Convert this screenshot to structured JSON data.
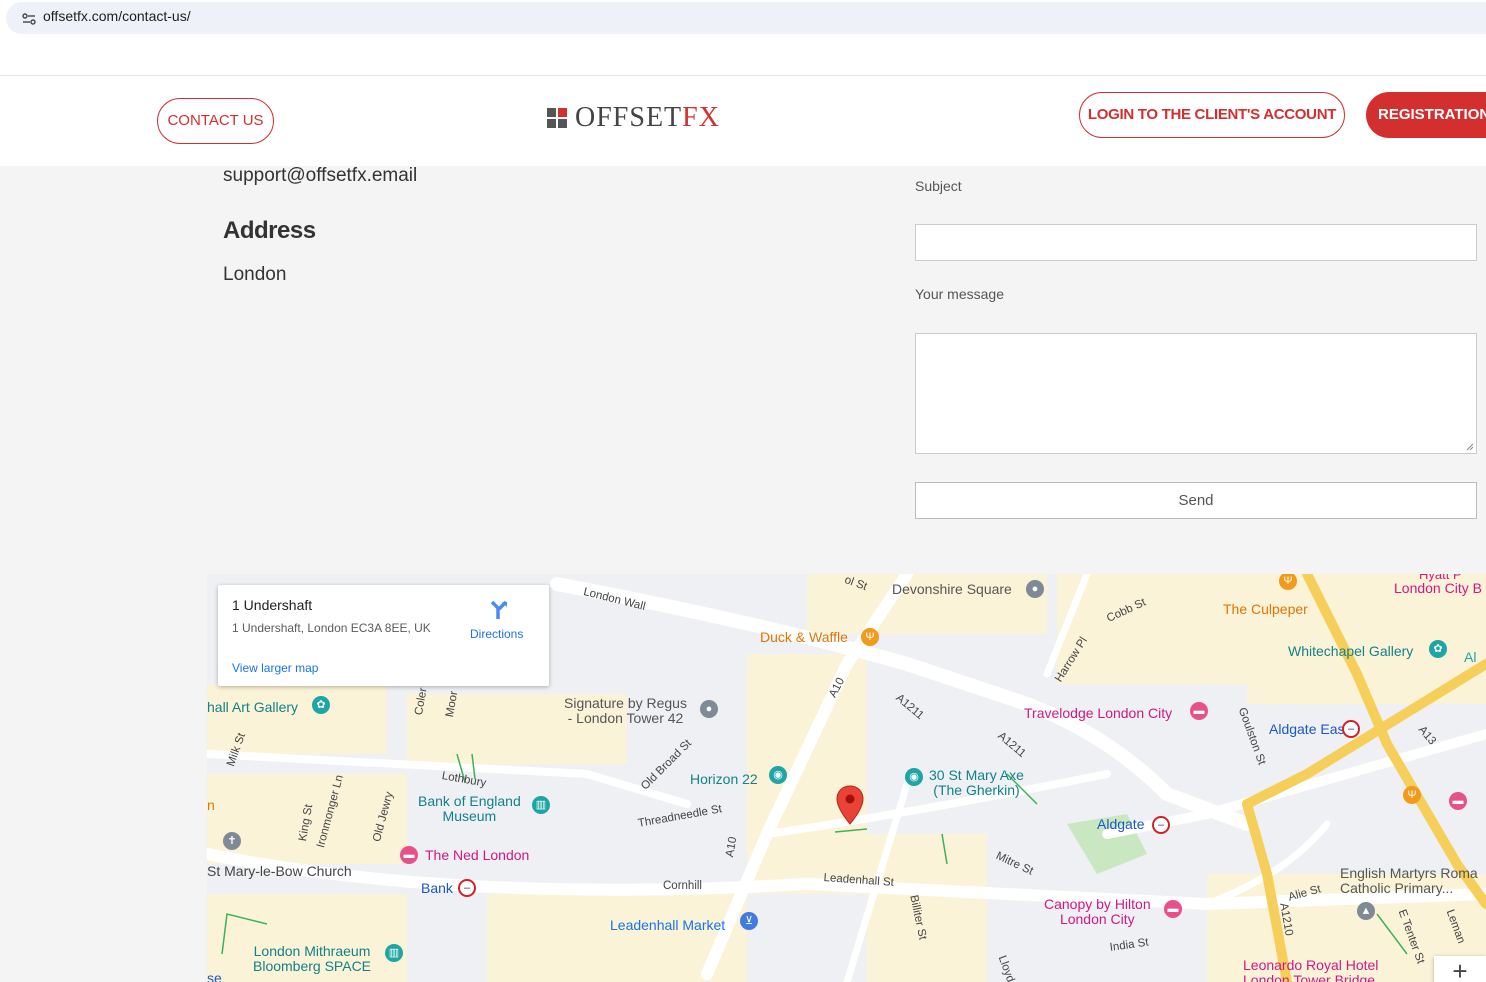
{
  "browser": {
    "url": "offsetfx.com/contact-us/"
  },
  "header": {
    "contact_label": "CONTACT US",
    "logo_offset": "OFFSET",
    "logo_fx": "FX",
    "login_label": "LOGIN TO THE CLIENT'S ACCOUNT",
    "registration_label": "REGISTRATION"
  },
  "contact_info": {
    "email": "support@offsetfx.email",
    "address_heading": "Address",
    "address": "London"
  },
  "form": {
    "subject_label": "Subject",
    "subject_value": "",
    "message_label": "Your message",
    "message_value": "",
    "send_label": "Send"
  },
  "map": {
    "place_name": "1 Undershaft",
    "place_address": "1 Undershaft, London EC3A 8EE, UK",
    "directions_label": "Directions",
    "larger_map_label": "View larger map",
    "zoom_in": "+",
    "pois": {
      "devonshire": "Devonshire Square",
      "duck_waffle": "Duck & Waffle",
      "culpeper": "The Culpeper",
      "whitechapel": "Whitechapel Gallery",
      "london_city_b": "London City B",
      "hyatt": "Hyatt P",
      "signature_1": "Signature by Regus",
      "signature_2": "- London Tower 42",
      "travelodge": "Travelodge London City",
      "aldgate_east": "Aldgate East",
      "art_gallery": "hall Art Gallery",
      "horizon": "Horizon 22",
      "gherkin_1": "30 St Mary Axe",
      "gherkin_2": "(The Gherkin)",
      "boe_1": "Bank of England",
      "boe_2": "Museum",
      "ned": "The Ned London",
      "aldgate": "Aldgate",
      "bow_church": "St Mary-le-Bow Church",
      "bank": "Bank",
      "canopy_1": "Canopy by Hilton",
      "canopy_2": "London City",
      "english_martyrs_1": "English Martyrs Roma",
      "english_martyrs_2": "Catholic Primary...",
      "leadenhall_market": "Leadenhall Market",
      "mithraeum_1": "London Mithraeum",
      "mithraeum_2": "Bloomberg SPACE",
      "leonardo_1": "Leonardo Royal Hotel",
      "leonardo_2": "London Tower Bridge",
      "se": "se",
      "n_edge": "n",
      "ai": "Al"
    },
    "roads": {
      "london_wall": "London Wall",
      "sol_st": "ol St",
      "cobb_st": "Cobb St",
      "harrow_pl": "Harrow Pl",
      "a10_top": "A10",
      "a1211_a": "A1211",
      "a1211_b": "A1211",
      "goulston": "Goulston St",
      "a13": "A13",
      "milk_st": "Milk St",
      "coleman": "Coler",
      "moor": "Moor",
      "lothbury": "Lothbury",
      "old_broad": "Old Broad St",
      "ironmonger": "Ironmonger Ln",
      "king_st": "King St",
      "old_jewry": "Old Jewry",
      "threadneedle": "Threadneedle St",
      "a10_bottom": "A10",
      "mitre_st": "Mitre St",
      "cornhill": "Cornhill",
      "leadenhall_st": "Leadenhall St",
      "billiter": "Billiter St",
      "alie_st": "Alie St",
      "a1210": "A1210",
      "e_tenter": "E Tenter St",
      "leman": "Leman",
      "india_st": "India St",
      "lloyd": "Lloyd"
    }
  },
  "colors": {
    "brand_red": "#d32f2f",
    "link_blue": "#1a73e8"
  }
}
